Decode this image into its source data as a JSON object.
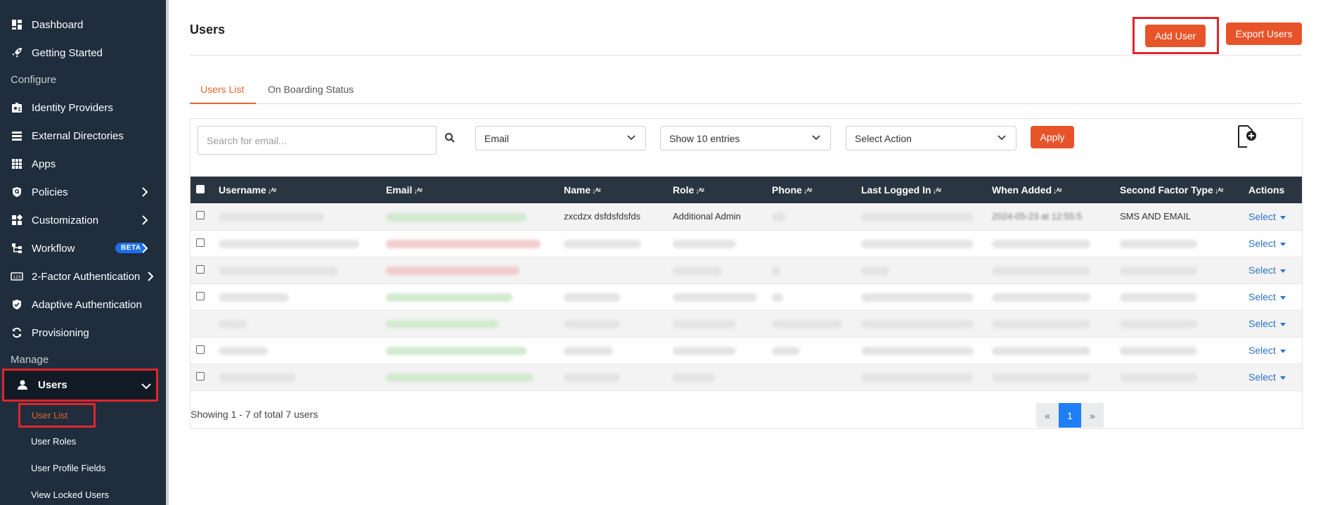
{
  "sidebar": {
    "dashboard": "Dashboard",
    "getting_started": "Getting Started",
    "configure": "Configure",
    "identity_providers": "Identity Providers",
    "external_directories": "External Directories",
    "apps": "Apps",
    "policies": "Policies",
    "customization": "Customization",
    "workflow": "Workflow",
    "workflow_badge": "BETA",
    "two_factor": "2-Factor Authentication",
    "adaptive": "Adaptive Authentication",
    "provisioning": "Provisioning",
    "manage": "Manage",
    "users": "Users",
    "sub": {
      "user_list": "User List",
      "user_roles": "User Roles",
      "user_profile_fields": "User Profile Fields",
      "view_locked_users": "View Locked Users"
    }
  },
  "header": {
    "title": "Users",
    "add_user": "Add User",
    "export_users": "Export Users"
  },
  "tabs": {
    "users_list": "Users List",
    "onboarding": "On Boarding Status"
  },
  "filters": {
    "search_placeholder": "Search for email...",
    "field_select": "Email",
    "entries_select": "Show 10 entries",
    "action_select": "Select Action",
    "apply": "Apply"
  },
  "table": {
    "columns": [
      "Username",
      "Email",
      "Name",
      "Role",
      "Phone",
      "Last Logged In",
      "When Added",
      "Second Factor Type",
      "Actions"
    ],
    "rows": [
      {
        "name": "zxcdzx dsfdsfdsfds",
        "role": "Additional Admin",
        "when_added": "2024-05-23 at 12:55:5",
        "second_factor": "SMS AND EMAIL",
        "action": "Select"
      },
      {
        "action": "Select"
      },
      {
        "action": "Select"
      },
      {
        "action": "Select"
      },
      {
        "action": "Select"
      },
      {
        "action": "Select"
      },
      {
        "action": "Select"
      }
    ]
  },
  "footer": {
    "showing": "Showing 1 - 7 of total 7 users",
    "prev": "«",
    "page": "1",
    "next": "»"
  }
}
